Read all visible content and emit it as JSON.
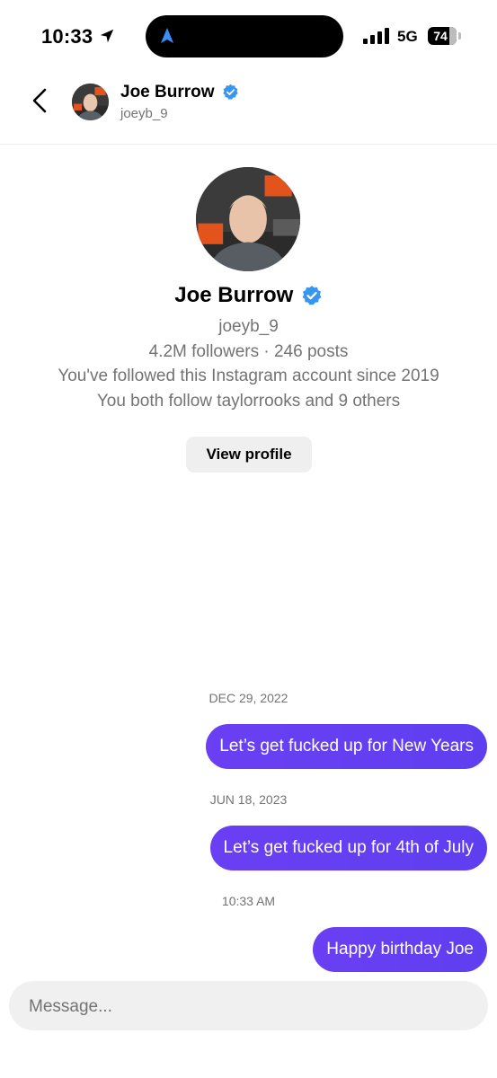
{
  "status_bar": {
    "time": "10:33",
    "network": "5G",
    "battery": "74",
    "icons": [
      "location-arrow-icon",
      "navigation-icon",
      "signal-bars-icon",
      "battery-icon"
    ]
  },
  "header": {
    "name": "Joe Burrow",
    "username": "joeyb_9",
    "back_icon": "chevron-left-icon",
    "verified_icon": "verified-badge-icon"
  },
  "profile": {
    "name": "Joe Burrow",
    "username": "joeyb_9",
    "stats": "4.2M followers · 246 posts",
    "followed_since": "You've followed this Instagram account since 2019",
    "mutual": "You both follow taylorrooks and 9 others",
    "view_profile_label": "View profile"
  },
  "thread": [
    {
      "date": "DEC 29, 2022",
      "message": "Let’s get fucked up for New Years"
    },
    {
      "date": "JUN 18, 2023",
      "message": "Let’s get fucked up for 4th of July"
    },
    {
      "date": "10:33 AM",
      "message": "Happy birthday Joe"
    }
  ],
  "composer": {
    "placeholder": "Message..."
  },
  "colors": {
    "bubble": "#6a3cf2",
    "verified": "#3797f0",
    "muted_text": "#737373",
    "button_bg": "#efefef"
  }
}
